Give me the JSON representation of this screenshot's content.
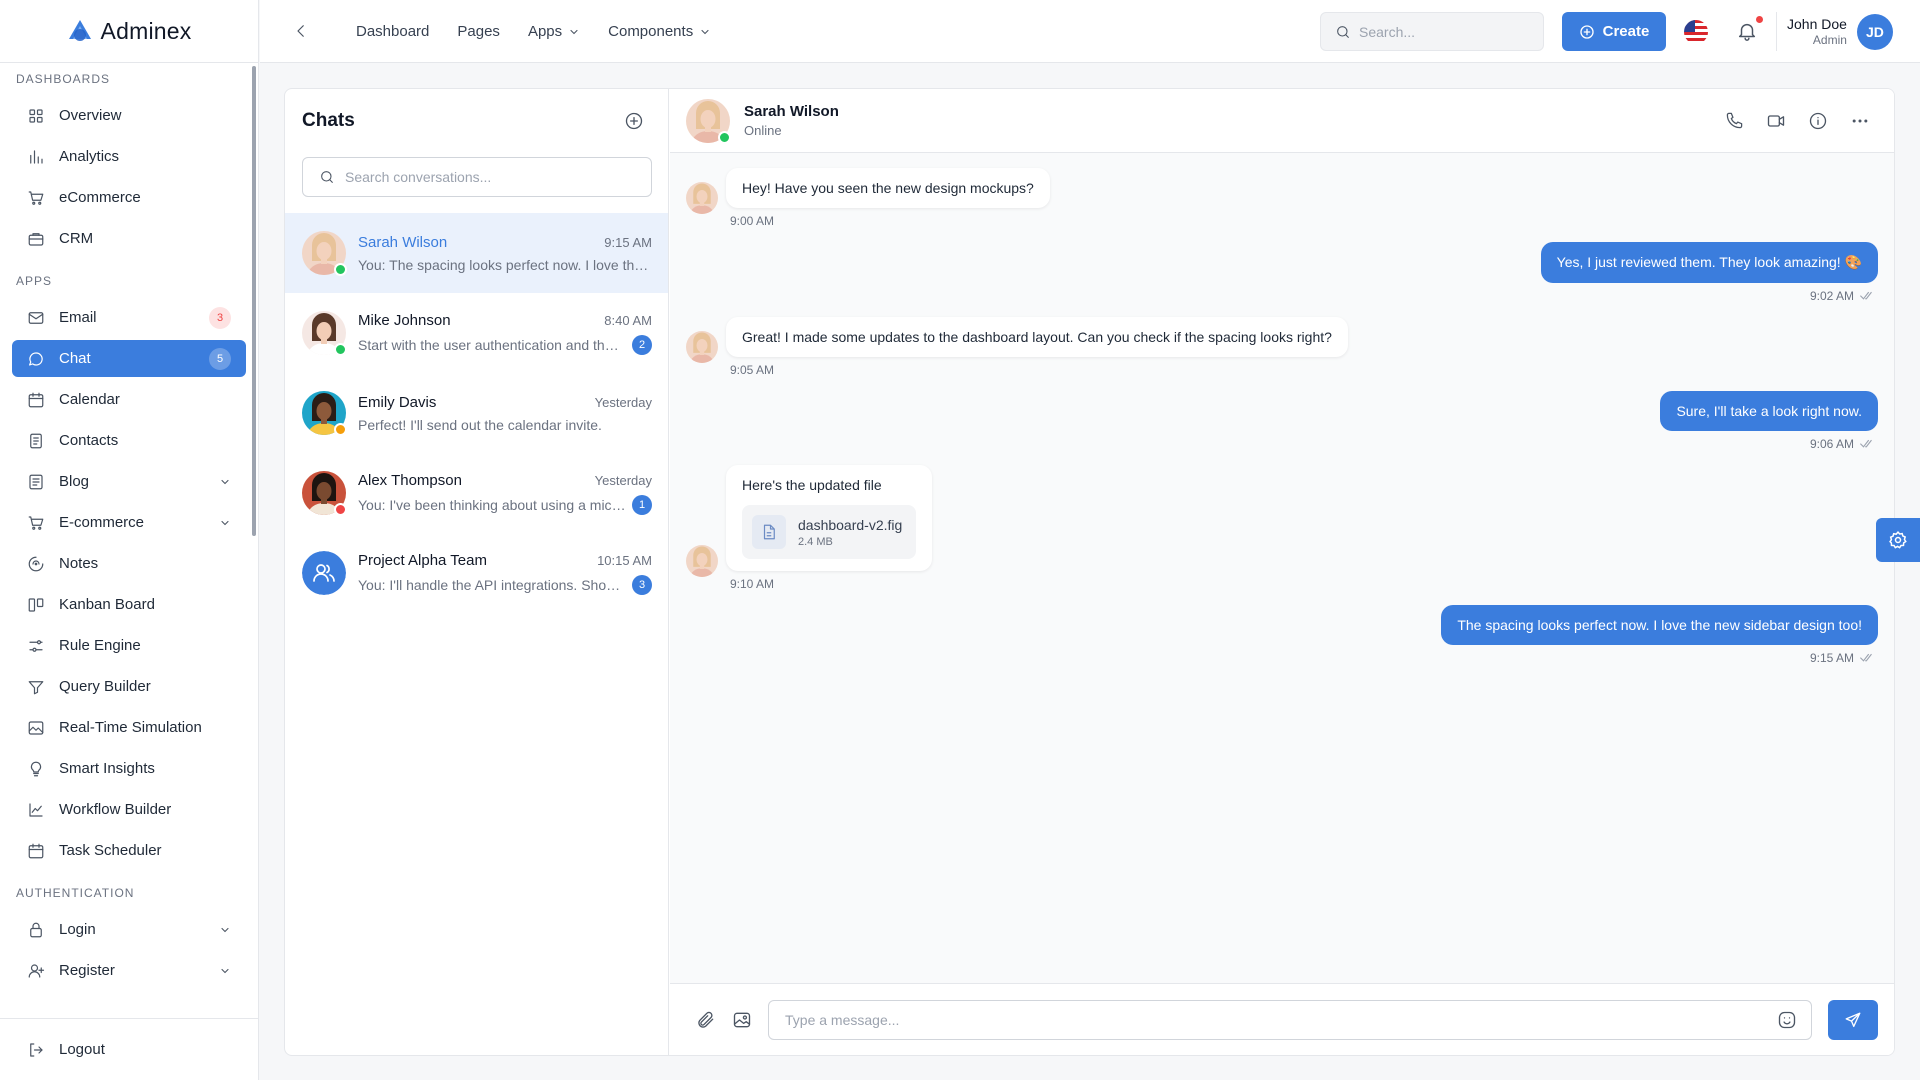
{
  "app": {
    "brand": "Adminex"
  },
  "sidebar": {
    "sections": [
      {
        "title": "Dashboards",
        "items": [
          {
            "label": "Overview",
            "icon": "grid-icon"
          },
          {
            "label": "Analytics",
            "icon": "bar-chart-icon"
          },
          {
            "label": "eCommerce",
            "icon": "cart-icon"
          },
          {
            "label": "CRM",
            "icon": "briefcase-icon"
          }
        ]
      },
      {
        "title": "Apps",
        "items": [
          {
            "label": "Email",
            "icon": "mail-icon",
            "badge": "3"
          },
          {
            "label": "Chat",
            "icon": "chat-icon",
            "badge": "5",
            "active": true
          },
          {
            "label": "Calendar",
            "icon": "calendar-icon"
          },
          {
            "label": "Contacts",
            "icon": "contacts-icon"
          },
          {
            "label": "Blog",
            "icon": "blog-icon",
            "expandable": true
          },
          {
            "label": "E-commerce",
            "icon": "cart-icon",
            "expandable": true
          },
          {
            "label": "Notes",
            "icon": "notes-icon"
          },
          {
            "label": "Kanban Board",
            "icon": "kanban-icon"
          },
          {
            "label": "Rule Engine",
            "icon": "sliders-icon"
          },
          {
            "label": "Query Builder",
            "icon": "funnel-icon"
          },
          {
            "label": "Real-Time Simulation",
            "icon": "image-chart-icon"
          },
          {
            "label": "Smart Insights",
            "icon": "lightbulb-icon"
          },
          {
            "label": "Workflow Builder",
            "icon": "line-chart-icon"
          },
          {
            "label": "Task Scheduler",
            "icon": "calendar-icon"
          }
        ]
      },
      {
        "title": "Authentication",
        "items": [
          {
            "label": "Login",
            "icon": "lock-icon",
            "expandable": true
          },
          {
            "label": "Register",
            "icon": "user-plus-icon",
            "expandable": true
          }
        ]
      }
    ],
    "logout_label": "Logout"
  },
  "topbar": {
    "nav": [
      {
        "label": "Dashboard",
        "dropdown": false
      },
      {
        "label": "Pages",
        "dropdown": false
      },
      {
        "label": "Apps",
        "dropdown": true
      },
      {
        "label": "Components",
        "dropdown": true
      }
    ],
    "search_placeholder": "Search...",
    "create_label": "Create",
    "user": {
      "name": "John Doe",
      "role": "Admin",
      "initials": "JD"
    }
  },
  "chats": {
    "title": "Chats",
    "search_placeholder": "Search conversations...",
    "conversations": [
      {
        "name": "Sarah Wilson",
        "time": "9:15 AM",
        "preview": "You: The spacing looks perfect now. I love the new sidebar design too!",
        "status": "online",
        "unread": "",
        "active": true,
        "avatar": "sarah"
      },
      {
        "name": "Mike Johnson",
        "time": "8:40 AM",
        "preview": "Start with the user authentication and then move to the dashboard",
        "status": "online",
        "unread": "2",
        "avatar": "mike"
      },
      {
        "name": "Emily Davis",
        "time": "Yesterday",
        "preview": "Perfect! I'll send out the calendar invite.",
        "status": "away",
        "unread": "",
        "avatar": "emily"
      },
      {
        "name": "Alex Thompson",
        "time": "Yesterday",
        "preview": "You: I've been thinking about using a microservices approach",
        "status": "busy",
        "unread": "1",
        "avatar": "alex"
      },
      {
        "name": "Project Alpha Team",
        "time": "10:15 AM",
        "preview": "You: I'll handle the API integrations. Should be done by Friday",
        "status": "",
        "unread": "3",
        "avatar": "group"
      }
    ]
  },
  "conversation": {
    "contact_name": "Sarah Wilson",
    "contact_status": "Online",
    "messages": [
      {
        "dir": "in",
        "text": "Hey! Have you seen the new design mockups?",
        "time": "9:00 AM"
      },
      {
        "dir": "out",
        "text": "Yes, I just reviewed them. They look amazing! 🎨",
        "time": "9:02 AM"
      },
      {
        "dir": "in",
        "text": "Great! I made some updates to the dashboard layout. Can you check if the spacing looks right?",
        "time": "9:05 AM"
      },
      {
        "dir": "out",
        "text": "Sure, I'll take a look right now.",
        "time": "9:06 AM"
      },
      {
        "dir": "in",
        "text": "Here's the updated file",
        "time": "9:10 AM",
        "file": {
          "name": "dashboard-v2.fig",
          "size": "2.4 MB"
        }
      },
      {
        "dir": "out",
        "text": "The spacing looks perfect now. I love the new sidebar design too!",
        "time": "9:15 AM"
      }
    ],
    "input_placeholder": "Type a message..."
  },
  "colors": {
    "accent": "#3b7ddd",
    "online": "#22c55e",
    "away": "#f59e0b",
    "busy": "#ef4444"
  }
}
